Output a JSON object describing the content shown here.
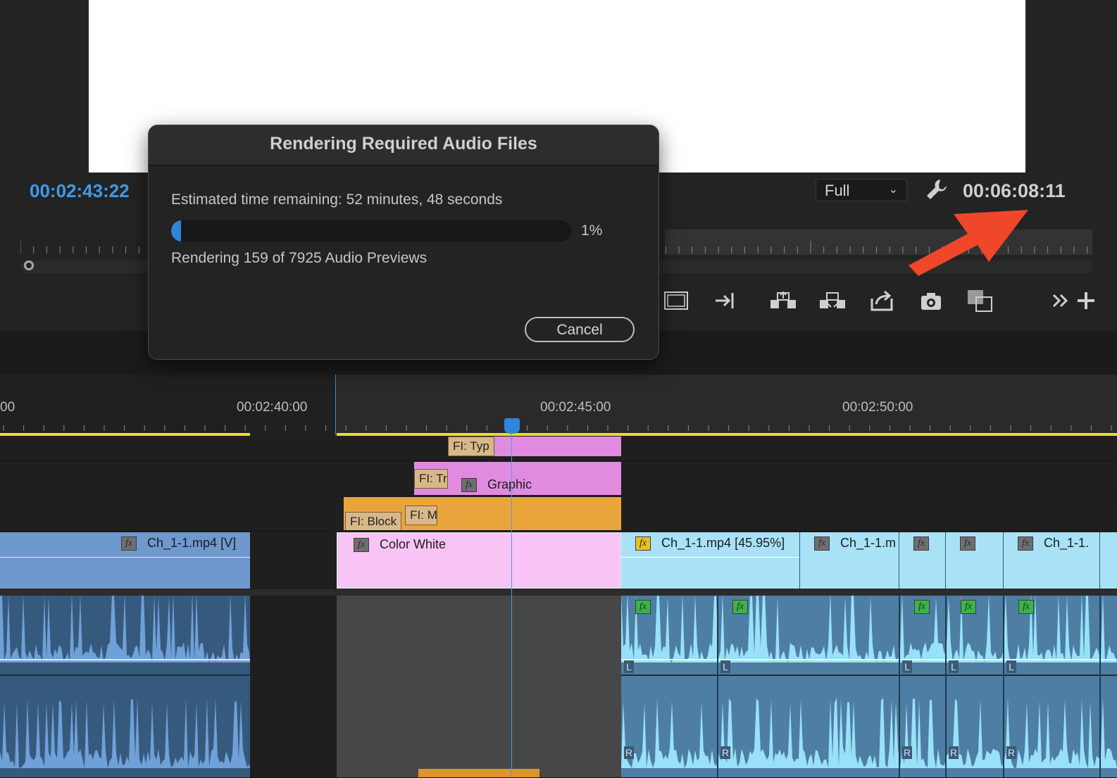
{
  "monitor": {
    "timecode_current": "00:02:43:22",
    "zoom_level": "Full",
    "timecode_duration": "00:06:08:11",
    "toolbar_icons": [
      "safe-margins-icon",
      "go-to-out-icon",
      "lift-icon",
      "extract-icon",
      "export-frame-icon",
      "camera-icon",
      "comparison-view-icon",
      "more-icon",
      "add-button-icon"
    ]
  },
  "dialog": {
    "title": "Rendering Required Audio Files",
    "time_remaining": "Estimated time remaining: 52 minutes, 48 seconds",
    "progress_percent": 1,
    "progress_label": "1%",
    "status": "Rendering 159 of 7925 Audio Previews",
    "cancel_label": "Cancel"
  },
  "timeline": {
    "ruler_labels": [
      "00",
      "00:02:40:00",
      "00:02:45:00",
      "00:02:50:00"
    ],
    "clips": {
      "v4_title": "FI: Typ",
      "v3_title": "FI: Tr",
      "v3_graphic": "Graphic",
      "v2_block": "FI: Block",
      "v2_m": "FI: M",
      "v1_left": "Ch_1-1.mp4 [V]",
      "v1_color": "Color White",
      "v1_main": "Ch_1-1.mp4 [45.95%]",
      "v1_b": "Ch_1-1.m",
      "v1_e": "Ch_1-1."
    },
    "channel_left": "L",
    "channel_right": "R"
  },
  "colors": {
    "accent_blue": "#2f86df",
    "timecode_blue": "#3d9be9",
    "work_area_yellow": "#e9e22a",
    "graphic_pink": "#e08be0",
    "title_orange": "#eaa43c",
    "video_blue_dark": "#6f98cf",
    "video_blue_light": "#a9e2f7",
    "color_matte_pink": "#f8c4f6",
    "annotation_arrow": "#f0462a"
  }
}
